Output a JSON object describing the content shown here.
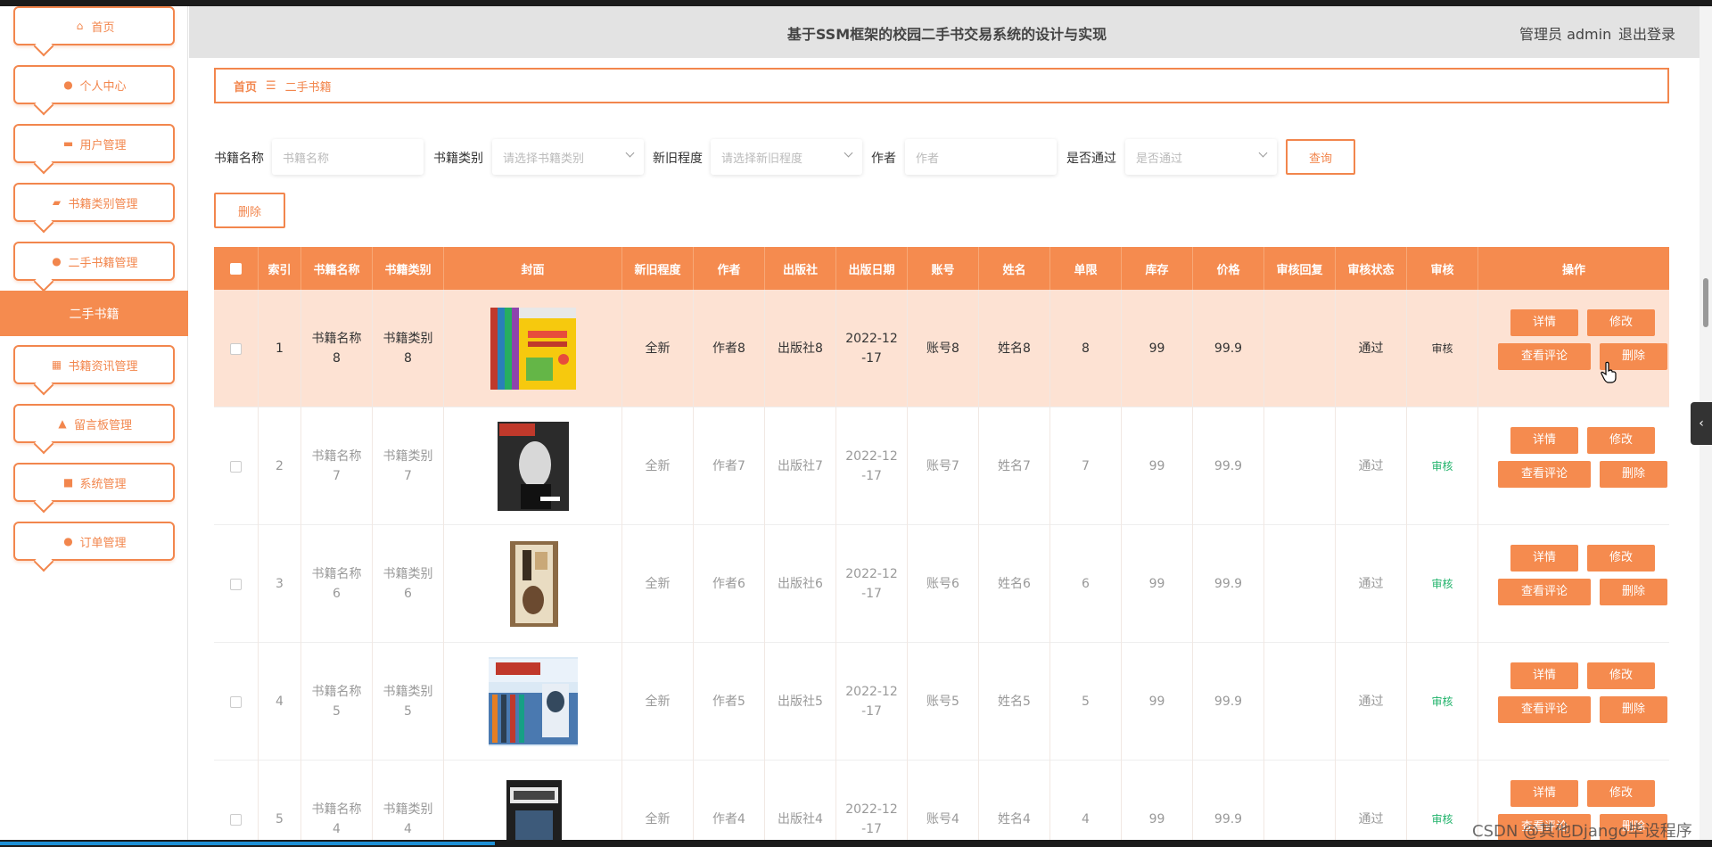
{
  "header": {
    "title": "基于SSM框架的校园二手书交易系统的设计与实现",
    "user": "管理员 admin",
    "logout": "退出登录"
  },
  "sidebar": {
    "items": [
      {
        "label": "首页",
        "icon": "home-icon"
      },
      {
        "label": "个人中心",
        "icon": "user-icon"
      },
      {
        "label": "用户管理",
        "icon": "users-icon"
      },
      {
        "label": "书籍类别管理",
        "icon": "ticket-icon"
      },
      {
        "label": "二手书籍管理",
        "icon": "user-icon"
      },
      {
        "label": "书籍资讯管理",
        "icon": "grid-icon"
      },
      {
        "label": "留言板管理",
        "icon": "thumb-icon"
      },
      {
        "label": "系统管理",
        "icon": "briefcase-icon"
      },
      {
        "label": "订单管理",
        "icon": "user-icon"
      }
    ],
    "active_sub": "二手书籍"
  },
  "breadcrumb": {
    "home": "首页",
    "sep": "☰",
    "current": "二手书籍"
  },
  "filters": {
    "name_label": "书籍名称",
    "name_placeholder": "书籍名称",
    "type_label": "书籍类别",
    "type_placeholder": "请选择书籍类别",
    "cond_label": "新旧程度",
    "cond_placeholder": "请选择新旧程度",
    "author_label": "作者",
    "author_placeholder": "作者",
    "pass_label": "是否通过",
    "pass_placeholder": "是否通过",
    "search": "查询",
    "delete": "删除"
  },
  "table": {
    "headers": [
      "索引",
      "书籍名称",
      "书籍类别",
      "封面",
      "新旧程度",
      "作者",
      "出版社",
      "出版日期",
      "账号",
      "姓名",
      "单限",
      "库存",
      "价格",
      "审核回复",
      "审核状态",
      "审核",
      "操作"
    ],
    "rows": [
      {
        "idx": "1",
        "name": "书籍名称\n8",
        "type": "书籍类别\n8",
        "cond": "全新",
        "author": "作者8",
        "press": "出版社8",
        "date": "2022-12\n-17",
        "account": "账号8",
        "realname": "姓名8",
        "limit": "8",
        "stock": "99",
        "price": "99.9",
        "reply": "",
        "status": "通过",
        "audit": "审核"
      },
      {
        "idx": "2",
        "name": "书籍名称\n7",
        "type": "书籍类别\n7",
        "cond": "全新",
        "author": "作者7",
        "press": "出版社7",
        "date": "2022-12\n-17",
        "account": "账号7",
        "realname": "姓名7",
        "limit": "7",
        "stock": "99",
        "price": "99.9",
        "reply": "",
        "status": "通过",
        "audit": "审核"
      },
      {
        "idx": "3",
        "name": "书籍名称\n6",
        "type": "书籍类别\n6",
        "cond": "全新",
        "author": "作者6",
        "press": "出版社6",
        "date": "2022-12\n-17",
        "account": "账号6",
        "realname": "姓名6",
        "limit": "6",
        "stock": "99",
        "price": "99.9",
        "reply": "",
        "status": "通过",
        "audit": "审核"
      },
      {
        "idx": "4",
        "name": "书籍名称\n5",
        "type": "书籍类别\n5",
        "cond": "全新",
        "author": "作者5",
        "press": "出版社5",
        "date": "2022-12\n-17",
        "account": "账号5",
        "realname": "姓名5",
        "limit": "5",
        "stock": "99",
        "price": "99.9",
        "reply": "",
        "status": "通过",
        "audit": "审核"
      },
      {
        "idx": "5",
        "name": "书籍名称\n4",
        "type": "书籍类别\n4",
        "cond": "全新",
        "author": "作者4",
        "press": "出版社4",
        "date": "2022-12\n-17",
        "account": "账号4",
        "realname": "姓名4",
        "limit": "4",
        "stock": "99",
        "price": "99.9",
        "reply": "",
        "status": "通过",
        "audit": "审核"
      }
    ],
    "actions": {
      "detail": "详情",
      "edit": "修改",
      "comments": "查看评论",
      "delete": "删除"
    }
  },
  "watermark": "CSDN @其他Django毕设程序",
  "colors": {
    "accent": "#f58b4f",
    "highlight_row": "#fde2d3",
    "audit_green": "#21b36b"
  }
}
